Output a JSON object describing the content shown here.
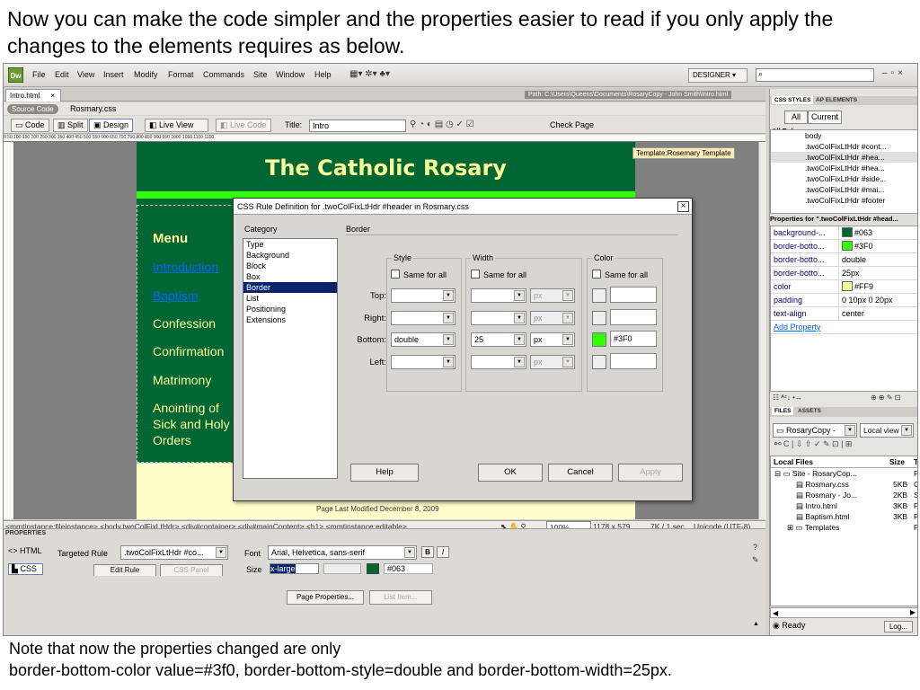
{
  "caption_top": "Now you can make the code simpler and the properties easier to read if you only apply the changes to the elements requires as below.",
  "caption_bottom_1": "Note that now the properties changed are only",
  "caption_bottom_2": "border-bottom-color value=#3f0, border-bottom-style=double and border-bottom-width=25px.",
  "app": {
    "logo": "Dw",
    "menu": [
      "File",
      "Edit",
      "View",
      "Insert",
      "Modify",
      "Format",
      "Commands",
      "Site",
      "Window",
      "Help"
    ],
    "workspace": "DESIGNER ▾",
    "doc_tab": "Intro.html",
    "path": "Path:  C:\\Users\\Queens\\Documents\\RosaryCopy - John Smith\\Intro.html",
    "source_code": "Source Code",
    "related_file": "Rosmary.css",
    "toolbar": {
      "code": "Code",
      "split": "Split",
      "design": "Design",
      "live_view": "Live View",
      "live_code": "Live Code",
      "title_label": "Title:",
      "title_value": "Intro",
      "check_page": "Check Page"
    },
    "ruler": "0     50    100    150    200    250    300    350    400    450    500    550    600    650    700    750    800    850    900    950    1000   1050   1100   1150"
  },
  "page": {
    "heading": "The Catholic Rosary",
    "menu_title": "Menu",
    "menu_items": [
      "Introduction",
      "Baptism",
      "Confession",
      "Confirmation",
      "Matrimony",
      "Anointing of",
      "Sick and Holy",
      "Orders"
    ],
    "footer": "Page Last Modified December 8, 2009",
    "template_badge": "Template:Rosemary Template"
  },
  "statusbar": {
    "tags": "<mmtinstance:fileinstance> <body.twoColFixLtHdr> <div#container> <div#mainContent> <h1> <mmtinstance:editable>",
    "zoom": "100%",
    "size": "1178 x 579",
    "speed": "7K / 1 sec",
    "encoding": "Unicode (UTF-8)"
  },
  "properties": {
    "header": "PROPERTIES",
    "html": "HTML",
    "css": "CSS",
    "targeted_rule_label": "Targeted Rule",
    "targeted_rule": ".twoColFixLtHdr #co...",
    "edit_rule": "Edit Rule",
    "css_panel": "CSS Panel",
    "font_label": "Font",
    "font_value": "Arial, Helvetica, sans-serif",
    "size_label": "Size",
    "size_value": "x-large",
    "color_value": "#063",
    "page_properties": "Page Properties...",
    "list_item": "List Item..."
  },
  "css_panel": {
    "tabs": [
      "CSS STYLES",
      "AP ELEMENTS"
    ],
    "all": "All",
    "current": "Current",
    "all_rules": "All Rules",
    "rules": [
      "body",
      ".twoColFixLtHdr #cont...",
      ".twoColFixLtHdr #hea...",
      ".twoColFixLtHdr #hea...",
      ".twoColFixLtHdr #side...",
      ".twoColFixLtHdr #mai...",
      ".twoColFixLtHdr #footer"
    ],
    "props_header": "Properties for \".twoColFixLtHdr #head...",
    "props": [
      {
        "k": "background-...",
        "v": "#063",
        "c": "#006633"
      },
      {
        "k": "border-botto...",
        "v": "#3F0",
        "c": "#33ff00"
      },
      {
        "k": "border-botto...",
        "v": "double",
        "c": ""
      },
      {
        "k": "border-botto...",
        "v": "25px",
        "c": ""
      },
      {
        "k": "color",
        "v": "#FF9",
        "c": "#ffff99"
      },
      {
        "k": "padding",
        "v": "0 10px 0 20px",
        "c": ""
      },
      {
        "k": "text-align",
        "v": "center",
        "c": ""
      }
    ],
    "add_property": "Add Property"
  },
  "files_panel": {
    "tabs": [
      "FILES",
      "ASSETS"
    ],
    "site": "RosaryCopy -",
    "view": "Local view",
    "col_local": "Local Files",
    "col_size": "Size",
    "col_type": "T",
    "rows": [
      {
        "name": "Site - RosaryCop...",
        "size": "",
        "type": "F"
      },
      {
        "name": "Rosmary.css",
        "size": "5KB",
        "type": "C"
      },
      {
        "name": "Rosmary - Jo...",
        "size": "2KB",
        "type": "S"
      },
      {
        "name": "Intro.html",
        "size": "3KB",
        "type": "F"
      },
      {
        "name": "Baptism.html",
        "size": "3KB",
        "type": "F"
      },
      {
        "name": "Templates",
        "size": "",
        "type": "F"
      }
    ],
    "status": "Ready",
    "log": "Log..."
  },
  "dialog": {
    "title": "CSS Rule Definition for .twoColFixLtHdr #header in Rosmary.css",
    "category_label": "Category",
    "section_label": "Border",
    "categories": [
      "Type",
      "Background",
      "Block",
      "Box",
      "Border",
      "List",
      "Positioning",
      "Extensions"
    ],
    "selected_category": "Border",
    "style_group": "Style",
    "width_group": "Width",
    "color_group": "Color",
    "same_for_all": "Same for all",
    "sides": [
      "Top:",
      "Right:",
      "Bottom:",
      "Left:"
    ],
    "bottom_style": "double",
    "bottom_width": "25",
    "unit": "px",
    "bottom_color": "#3F0",
    "help": "Help",
    "ok": "OK",
    "cancel": "Cancel",
    "apply": "Apply"
  },
  "colors": {
    "header_green": "#006633",
    "border_green": "#33ff00",
    "text_yellow": "#ffff99",
    "footer_bg": "#ffffcc"
  }
}
